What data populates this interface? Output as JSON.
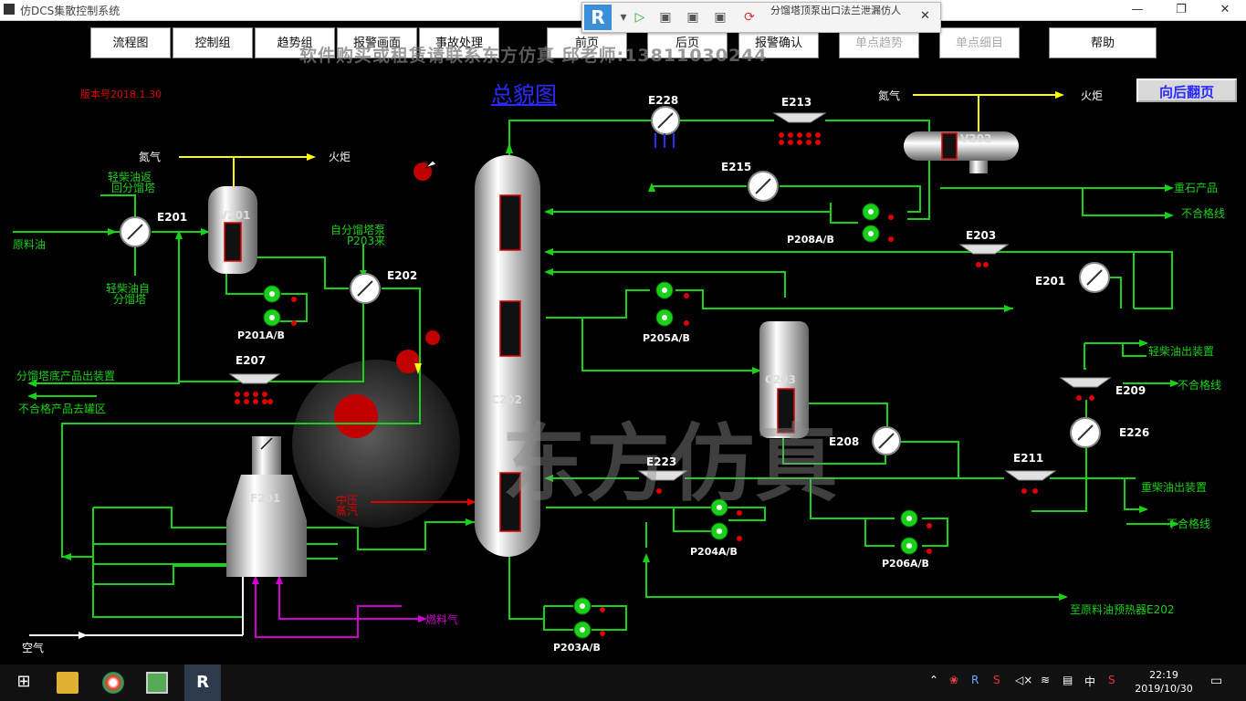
{
  "window": {
    "title": "仿DCS集散控制系统",
    "minimize": "—",
    "restore": "❐",
    "close": "✕"
  },
  "floatbar": {
    "logo": "R",
    "text": "分馏塔顶泵出口法兰泄漏仿人",
    "close": "✕"
  },
  "menu": [
    "流程图",
    "控制组",
    "趋势组",
    "报警画面",
    "事故处理",
    "前页",
    "后页",
    "报警确认",
    "单点趋势",
    "单点细目",
    "帮助"
  ],
  "watermark_top": "软件购买或租赁请联系东方仿真 邱老师:13811030244",
  "watermark_big": "东方仿真",
  "version": "版本号2018.1.30",
  "page_title": "总貌图",
  "back_page_button": "向后翻页",
  "equipment": {
    "E228": "E228",
    "E213": "E213",
    "V202": "V202",
    "E215": "E215",
    "P208": "P208A/B",
    "E203": "E203",
    "E201_right": "E201",
    "P205": "P205A/B",
    "C203": "C203",
    "E209": "E209",
    "E226": "E226",
    "E208": "E208",
    "E211": "E211",
    "E223": "E223",
    "P204": "P204A/B",
    "P206": "P206A/B",
    "P203": "P203A/B",
    "C202": "C202",
    "F201": "F201",
    "V201": "V201",
    "E201_left": "E201",
    "E202": "E202",
    "P201": "P201A/B",
    "E207": "E207"
  },
  "labels": {
    "nitrogen_top": "氮气",
    "flare_top": "火炬",
    "nitrogen_left": "氮气",
    "flare_left": "火炬",
    "light_diesel_return": "轻柴油返\n回分馏塔",
    "feed_oil": "原料油",
    "light_diesel_from": "轻柴油自\n分馏塔",
    "from_p203": "自分馏塔泵\nP203来",
    "bottom_product": "分馏塔底产品出装置",
    "offspec_tank": "不合格产品去罐区",
    "medium_steam": "中压\n蒸汽",
    "fuel_gas": "燃料气",
    "air": "空气",
    "heavy_naphtha": "重石产品",
    "offspec1": "不合格线",
    "light_diesel_out": "轻柴油出装置",
    "offspec2": "不合格线",
    "heavy_diesel_out": "重柴油出装置",
    "offspec3": "不合格线",
    "to_preheater": "至原料油预热器E202"
  },
  "taskbar": {
    "time": "22:19",
    "date": "2019/10/30",
    "ime": "中",
    "app_r": "R"
  },
  "colors": {
    "pipe": "#1ad11a",
    "pipe_alt": "#00ff00",
    "fuel": "#d000d0",
    "alarm": "#e00000",
    "steam": "#e00000"
  }
}
